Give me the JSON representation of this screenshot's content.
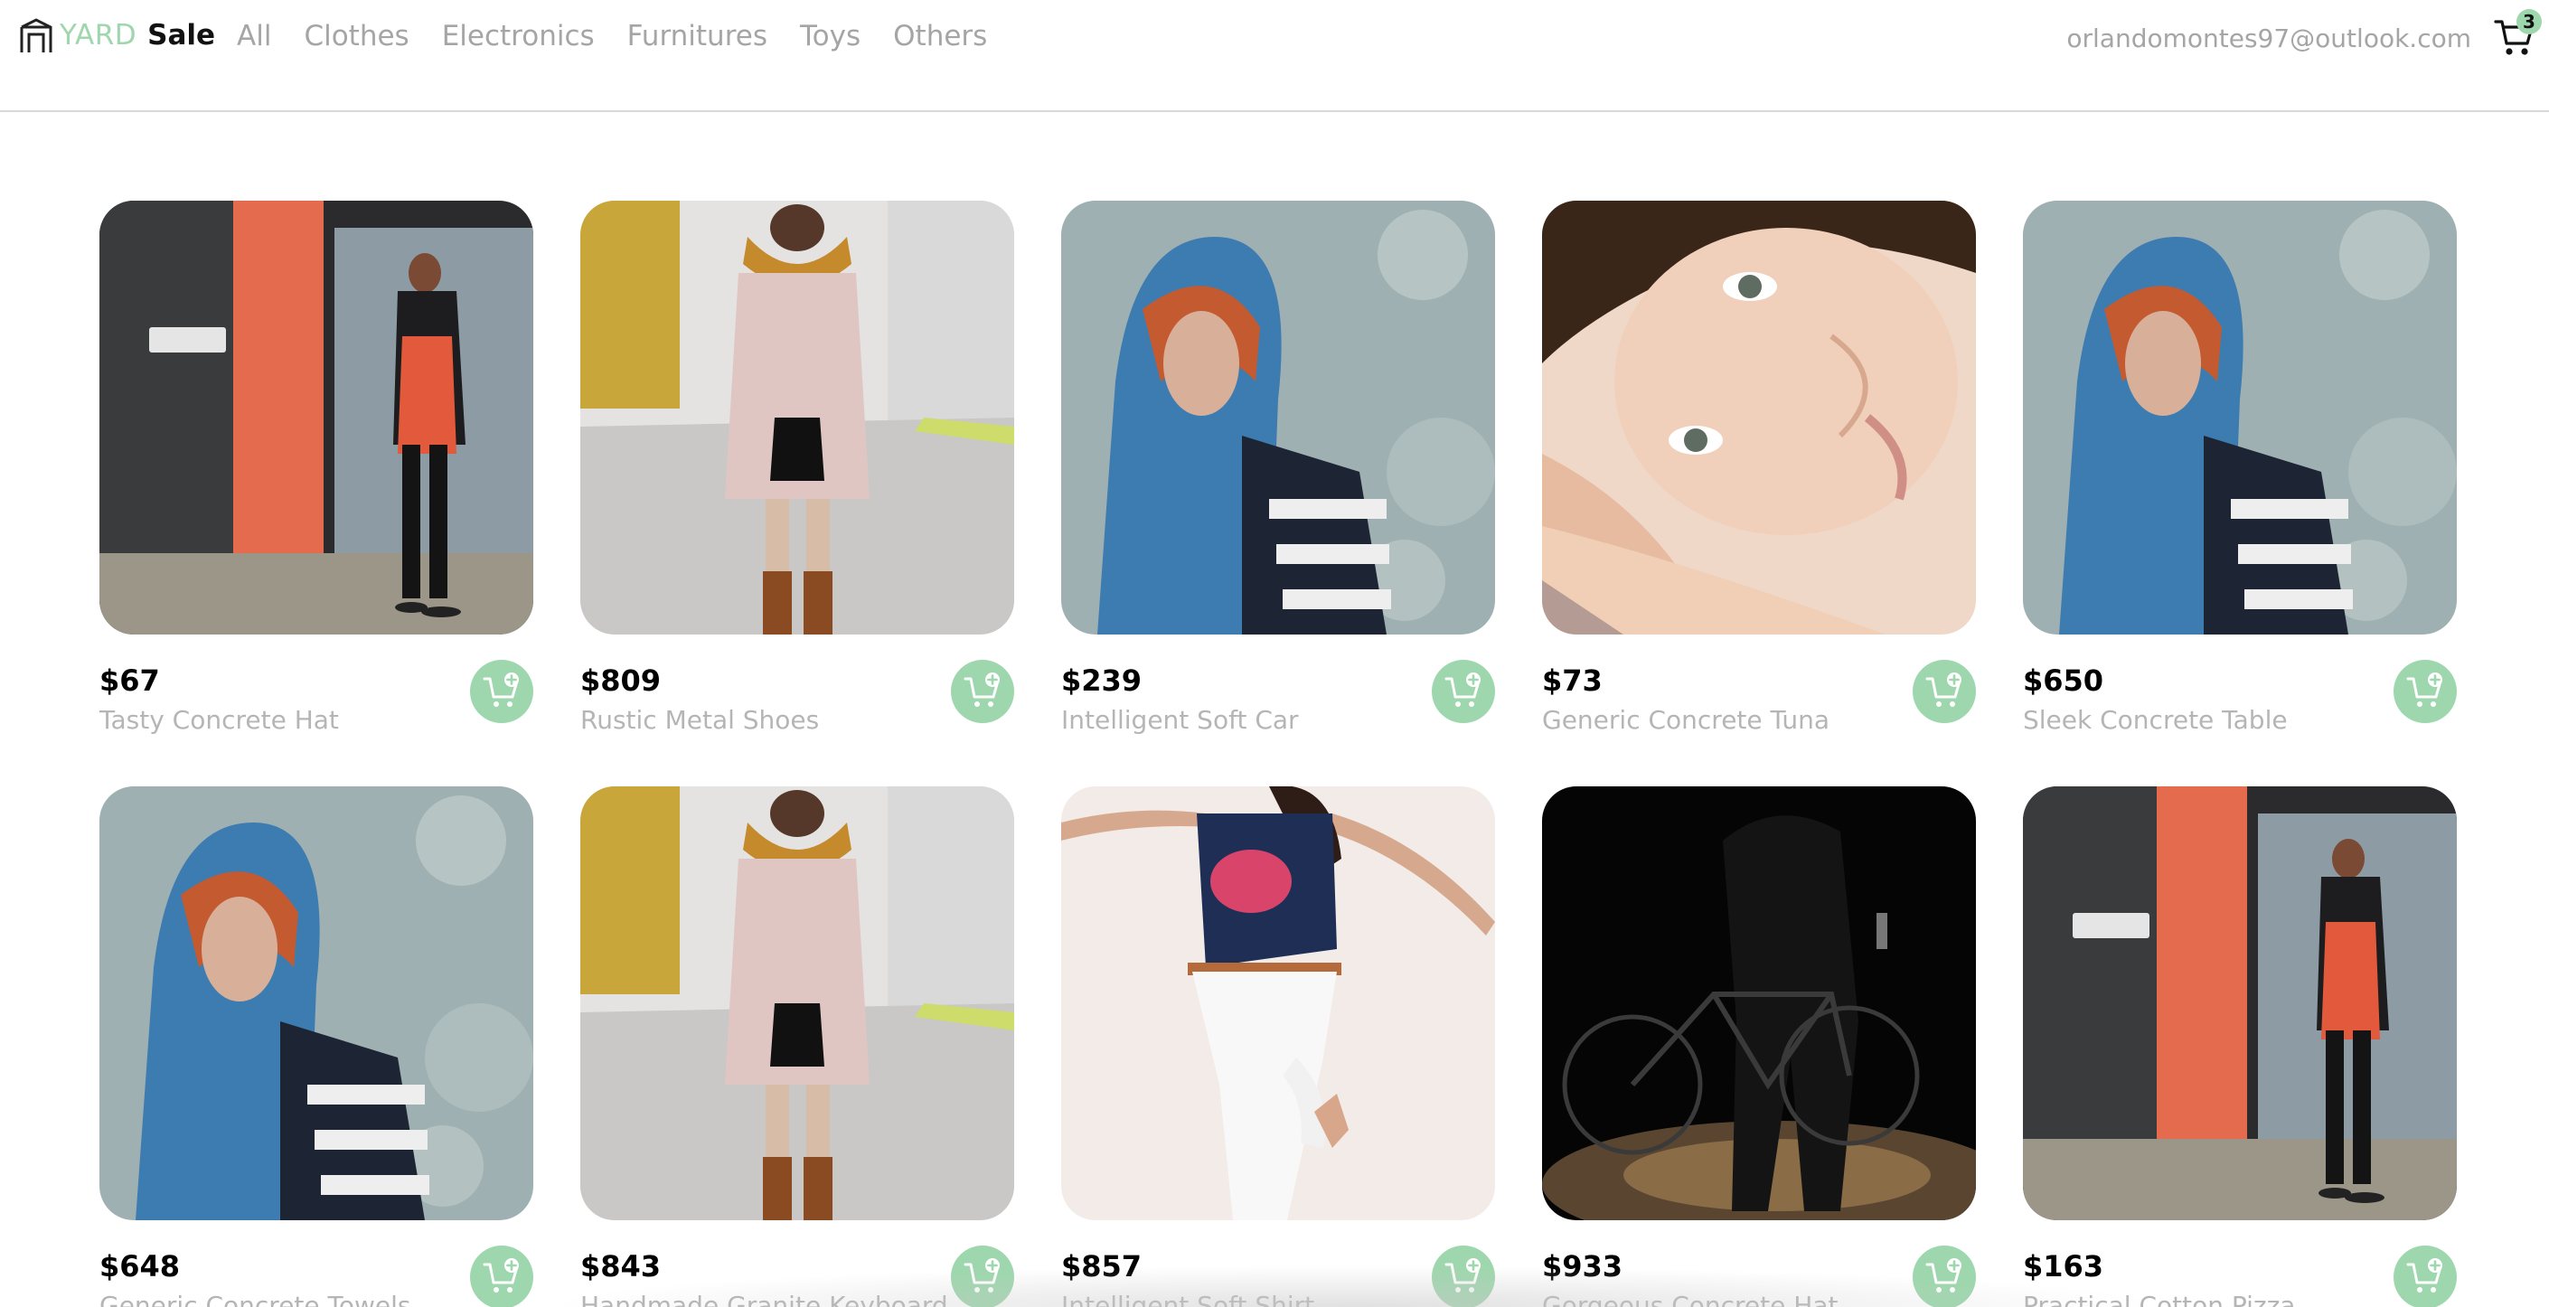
{
  "brand": {
    "yard": "YARD",
    "sale": "Sale"
  },
  "nav": {
    "categories": [
      "All",
      "Clothes",
      "Electronics",
      "Furnitures",
      "Toys",
      "Others"
    ],
    "email": "orlandomontes97@outlook.com",
    "cart_count": "3"
  },
  "colors": {
    "accent": "#9ed7ad",
    "muted_text": "#a5a5a5"
  },
  "products": [
    {
      "price": "$67",
      "name": "Tasty Concrete Hat",
      "image": "woman-red-dress-phone"
    },
    {
      "price": "$809",
      "name": "Rustic Metal Shoes",
      "image": "woman-pink-coat-scarf"
    },
    {
      "price": "$239",
      "name": "Intelligent Soft Car",
      "image": "woman-blue-headscarf"
    },
    {
      "price": "$73",
      "name": "Generic Concrete Tuna",
      "image": "woman-face-closeup"
    },
    {
      "price": "$650",
      "name": "Sleek Concrete Table",
      "image": "woman-blue-headscarf"
    },
    {
      "price": "$648",
      "name": "Generic Concrete Towels",
      "image": "woman-blue-headscarf"
    },
    {
      "price": "$843",
      "name": "Handmade Granite Keyboard",
      "image": "woman-pink-coat-scarf"
    },
    {
      "price": "$857",
      "name": "Intelligent Soft Shirt",
      "image": "woman-heart-tshirt-jumping"
    },
    {
      "price": "$933",
      "name": "Gorgeous Concrete Hat",
      "image": "man-bicycle-night"
    },
    {
      "price": "$163",
      "name": "Practical Cotton Pizza",
      "image": "woman-red-dress-phone"
    }
  ]
}
